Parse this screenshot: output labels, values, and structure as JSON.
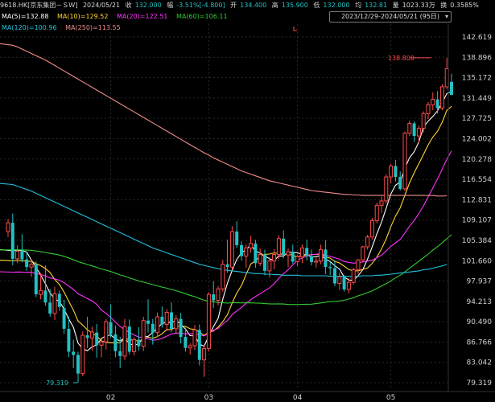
{
  "header": {
    "symbol": "9618.HK[京东集团－ＳＷ]",
    "date": "2024/05/21",
    "close_label": "收",
    "close": "132.000",
    "change_label": "幅",
    "change": "-3.51%[-4.800]",
    "open_label": "开",
    "open": "134.400",
    "high_label": "高",
    "high": "135.900",
    "low_label": "低",
    "low": "132.000",
    "avg_label": "均",
    "avg": "132.81",
    "volume_label": "量",
    "volume": "1023.33万",
    "turnover_label": "换",
    "turnover": "0.3585%"
  },
  "range_selector": {
    "label": "2023/12/29-2024/05/21 (95日)",
    "caret": "▾"
  },
  "colors": {
    "up": "#ff4a4a",
    "down": "#22c1c3",
    "ma5": "#ffffff",
    "ma10": "#ffd633",
    "ma20": "#ff33ff",
    "ma60": "#33cc33",
    "ma120": "#22c1dd",
    "ma250": "#f08c8c"
  },
  "chart_data": {
    "type": "candlestick",
    "moving_averages": [
      {
        "name": "MA(5)",
        "label": "MA(5)=132.88"
      },
      {
        "name": "MA(10)",
        "label": "MA(10)=129.52"
      },
      {
        "name": "MA(20)",
        "label": "MA(20)=122.51"
      },
      {
        "name": "MA(60)",
        "label": "MA(60)=106.11"
      },
      {
        "name": "MA(120)",
        "label": "MA(120)=100.96"
      },
      {
        "name": "MA(250)",
        "label": "MA(250)=113.55"
      }
    ],
    "y_ticks": [
      "142.619",
      "138.896",
      "135.172",
      "131.449",
      "127.725",
      "124.002",
      "120.278",
      "116.554",
      "112.831",
      "109.107",
      "105.384",
      "101.660",
      "97.937",
      "94.213",
      "90.490",
      "86.766",
      "83.042",
      "79.319"
    ],
    "ylim": [
      78.0,
      143.5
    ],
    "x_ticks": [
      {
        "label": "02",
        "index": 22
      },
      {
        "label": "03",
        "index": 43
      },
      {
        "label": "04",
        "index": 62
      },
      {
        "label": "05",
        "index": 82
      }
    ],
    "annotations": {
      "high": {
        "label": "138.800",
        "value": 138.8,
        "index": 91
      },
      "low": {
        "label": "79.319",
        "value": 79.319,
        "index": 15
      }
    },
    "candles": [
      [
        107.0,
        109.3,
        106.0,
        108.6
      ],
      [
        108.6,
        110.3,
        100.8,
        102.0
      ],
      [
        102.0,
        104.5,
        101.2,
        103.4
      ],
      [
        103.5,
        106.5,
        101.4,
        101.9
      ],
      [
        101.9,
        103.3,
        99.8,
        100.5
      ],
      [
        100.5,
        102.0,
        98.7,
        101.0
      ],
      [
        101.0,
        101.5,
        95.0,
        95.5
      ],
      [
        95.5,
        99.4,
        94.6,
        96.2
      ],
      [
        96.2,
        100.8,
        93.4,
        94.0
      ],
      [
        94.0,
        96.5,
        91.4,
        92.0
      ],
      [
        92.0,
        96.9,
        90.8,
        95.6
      ],
      [
        95.6,
        96.2,
        92.5,
        93.2
      ],
      [
        93.0,
        94.5,
        88.3,
        89.2
      ],
      [
        89.2,
        91.4,
        84.0,
        85.0
      ],
      [
        85.0,
        87.2,
        82.0,
        84.4
      ],
      [
        84.4,
        85.0,
        79.3,
        81.0
      ],
      [
        81.0,
        88.7,
        80.5,
        88.0
      ],
      [
        88.0,
        91.4,
        85.7,
        87.5
      ],
      [
        87.5,
        89.6,
        85.2,
        88.6
      ],
      [
        88.5,
        90.1,
        83.9,
        86.2
      ],
      [
        86.2,
        87.3,
        84.0,
        86.8
      ],
      [
        86.8,
        91.0,
        85.4,
        90.5
      ],
      [
        90.4,
        93.7,
        87.6,
        88.2
      ],
      [
        88.2,
        89.8,
        84.0,
        85.1
      ],
      [
        85.1,
        87.7,
        82.0,
        84.2
      ],
      [
        84.2,
        91.0,
        83.5,
        89.6
      ],
      [
        89.6,
        90.9,
        84.5,
        85.0
      ],
      [
        85.0,
        87.6,
        84.3,
        87.2
      ],
      [
        87.2,
        89.5,
        85.2,
        86.0
      ],
      [
        86.0,
        91.4,
        85.1,
        90.7
      ],
      [
        90.7,
        94.6,
        88.5,
        90.1
      ],
      [
        90.1,
        91.0,
        86.3,
        88.5
      ],
      [
        88.5,
        92.2,
        87.7,
        91.4
      ],
      [
        91.4,
        93.3,
        89.4,
        90.0
      ],
      [
        90.0,
        92.8,
        88.8,
        92.2
      ],
      [
        92.2,
        94.0,
        88.6,
        89.2
      ],
      [
        89.2,
        91.7,
        88.2,
        91.0
      ],
      [
        91.0,
        92.1,
        86.5,
        87.7
      ],
      [
        87.7,
        89.4,
        85.0,
        85.7
      ],
      [
        85.7,
        86.5,
        84.5,
        86.1
      ],
      [
        86.1,
        89.9,
        85.3,
        89.0
      ],
      [
        89.0,
        90.0,
        82.5,
        83.5
      ],
      [
        83.5,
        86.2,
        80.4,
        85.6
      ],
      [
        85.6,
        95.9,
        85.0,
        95.5
      ],
      [
        95.5,
        97.9,
        93.0,
        94.4
      ],
      [
        94.4,
        97.0,
        93.5,
        96.5
      ],
      [
        96.5,
        101.8,
        96.0,
        101.0
      ],
      [
        101.0,
        105.5,
        99.5,
        100.5
      ],
      [
        100.5,
        108.0,
        100.0,
        107.0
      ],
      [
        107.0,
        108.9,
        104.0,
        104.5
      ],
      [
        104.5,
        105.2,
        101.7,
        102.5
      ],
      [
        102.5,
        104.6,
        100.4,
        104.0
      ],
      [
        104.0,
        106.2,
        103.1,
        104.8
      ],
      [
        104.8,
        105.5,
        100.4,
        101.2
      ],
      [
        101.2,
        103.9,
        100.7,
        102.8
      ],
      [
        102.8,
        103.7,
        99.0,
        99.8
      ],
      [
        99.8,
        102.3,
        98.6,
        101.6
      ],
      [
        101.6,
        103.8,
        100.1,
        102.8
      ],
      [
        102.8,
        106.3,
        102.0,
        105.7
      ],
      [
        105.7,
        107.2,
        102.1,
        102.7
      ],
      [
        102.7,
        103.9,
        100.5,
        103.3
      ],
      [
        103.3,
        104.6,
        101.1,
        101.5
      ],
      [
        101.5,
        102.7,
        100.7,
        102.4
      ],
      [
        102.4,
        104.6,
        101.2,
        104.0
      ],
      [
        104.0,
        105.5,
        101.8,
        102.5
      ],
      [
        102.5,
        103.7,
        100.8,
        101.4
      ],
      [
        101.4,
        102.2,
        100.4,
        101.6
      ],
      [
        101.6,
        104.6,
        101.0,
        103.7
      ],
      [
        103.7,
        105.4,
        99.2,
        100.5
      ],
      [
        100.5,
        101.5,
        99.0,
        100.3
      ],
      [
        100.3,
        101.7,
        97.0,
        97.5
      ],
      [
        97.5,
        99.5,
        96.3,
        98.7
      ],
      [
        98.7,
        99.0,
        96.0,
        96.4
      ],
      [
        96.4,
        98.5,
        95.7,
        97.7
      ],
      [
        97.7,
        100.4,
        97.3,
        100.0
      ],
      [
        100.0,
        102.0,
        99.2,
        101.8
      ],
      [
        101.8,
        104.4,
        101.5,
        104.2
      ],
      [
        104.2,
        106.4,
        103.7,
        106.0
      ],
      [
        106.0,
        109.5,
        105.5,
        109.0
      ],
      [
        109.0,
        112.3,
        108.5,
        111.8
      ],
      [
        111.8,
        113.4,
        110.5,
        112.6
      ],
      [
        112.6,
        117.5,
        112.1,
        117.0
      ],
      [
        117.0,
        119.4,
        115.8,
        119.0
      ],
      [
        119.0,
        120.1,
        116.2,
        117.0
      ],
      [
        117.0,
        118.0,
        114.5,
        114.8
      ],
      [
        114.8,
        125.3,
        114.4,
        125.0
      ],
      [
        125.0,
        127.3,
        124.5,
        126.8
      ],
      [
        126.8,
        127.2,
        123.4,
        124.5
      ],
      [
        124.5,
        126.4,
        123.2,
        125.9
      ],
      [
        125.9,
        129.0,
        125.1,
        128.6
      ],
      [
        128.6,
        130.7,
        127.6,
        130.2
      ],
      [
        130.2,
        132.5,
        129.2,
        131.2
      ],
      [
        131.2,
        132.7,
        128.6,
        129.6
      ],
      [
        129.6,
        134.0,
        129.2,
        133.5
      ],
      [
        133.5,
        138.8,
        133.1,
        136.8
      ],
      [
        134.4,
        135.9,
        132.0,
        132.0
      ]
    ],
    "ma120": [
      115.8,
      115.6,
      115.3,
      115.0,
      114.7,
      114.4,
      114.0,
      113.6,
      113.2,
      112.8,
      112.4,
      112.0,
      111.6,
      111.2,
      110.8,
      110.4,
      110.0,
      109.6,
      109.2,
      108.8,
      108.4,
      108.0,
      107.6,
      107.2,
      106.8,
      106.4,
      106.0,
      105.6,
      105.2,
      104.8,
      104.4,
      104.0,
      103.7,
      103.4,
      103.1,
      102.8,
      102.5,
      102.2,
      101.9,
      101.6,
      101.3,
      101.0,
      100.8,
      100.6,
      100.4,
      100.2,
      100.0,
      99.9,
      99.8,
      99.7,
      99.6,
      99.5,
      99.4,
      99.3,
      99.3,
      99.2,
      99.2,
      99.1,
      99.1,
      99.0,
      99.0,
      99.0,
      99.0,
      98.9,
      98.9,
      98.9,
      98.9,
      98.9,
      98.9,
      98.8,
      98.8,
      98.8,
      98.8,
      98.8,
      98.8,
      98.8,
      98.9,
      98.9,
      98.9,
      99.0,
      99.0,
      99.1,
      99.2,
      99.3,
      99.4,
      99.5,
      99.6,
      99.7,
      99.8,
      100.0,
      100.1,
      100.3,
      100.5,
      100.7,
      100.96
    ],
    "ma250": [
      141.4,
      141.1,
      140.8,
      140.4,
      140.0,
      139.6,
      139.2,
      138.8,
      138.4,
      137.9,
      137.4,
      136.9,
      136.4,
      135.9,
      135.4,
      134.9,
      134.4,
      133.9,
      133.4,
      132.9,
      132.4,
      131.9,
      131.4,
      130.9,
      130.4,
      129.9,
      129.4,
      128.9,
      128.4,
      127.9,
      127.4,
      126.9,
      126.4,
      125.9,
      125.4,
      124.9,
      124.4,
      123.9,
      123.4,
      122.9,
      122.4,
      121.9,
      121.4,
      121.0,
      120.5,
      120.1,
      119.7,
      119.3,
      118.9,
      118.5,
      118.1,
      117.8,
      117.5,
      117.2,
      116.9,
      116.6,
      116.3,
      116.1,
      115.9,
      115.7,
      115.5,
      115.3,
      115.1,
      114.9,
      114.7,
      114.5,
      114.4,
      114.3,
      114.2,
      114.1,
      114.0,
      113.9,
      113.8,
      113.8,
      113.7,
      113.7,
      113.6,
      113.6,
      113.6,
      113.6,
      113.6,
      113.6,
      113.6,
      113.6,
      113.6,
      113.6,
      113.6,
      113.6,
      113.6,
      113.6,
      113.6,
      113.6,
      113.5,
      113.5,
      113.55
    ],
    "ma60_pre": [
      102.4,
      102.6,
      102.7,
      102.9,
      103.0,
      103.0,
      103.1,
      103.1,
      103.1,
      103.1,
      103.2,
      103.2,
      103.2,
      103.2,
      103.3,
      103.3,
      103.3,
      103.3,
      103.4,
      103.4,
      103.4,
      103.4,
      103.4,
      103.5,
      103.5,
      103.5,
      103.5,
      103.5,
      103.6,
      103.6,
      103.6,
      103.6,
      103.7,
      103.7,
      103.7,
      103.7,
      103.7,
      103.8,
      103.8,
      103.8,
      103.8,
      103.8,
      103.9,
      103.9,
      103.9,
      103.9,
      104.0,
      104.0,
      104.0,
      104.0,
      104.0,
      104.1,
      104.1,
      104.1,
      104.1,
      104.2,
      104.2,
      104.2,
      104.2
    ]
  },
  "left_edge": {
    "data_start": 0
  }
}
